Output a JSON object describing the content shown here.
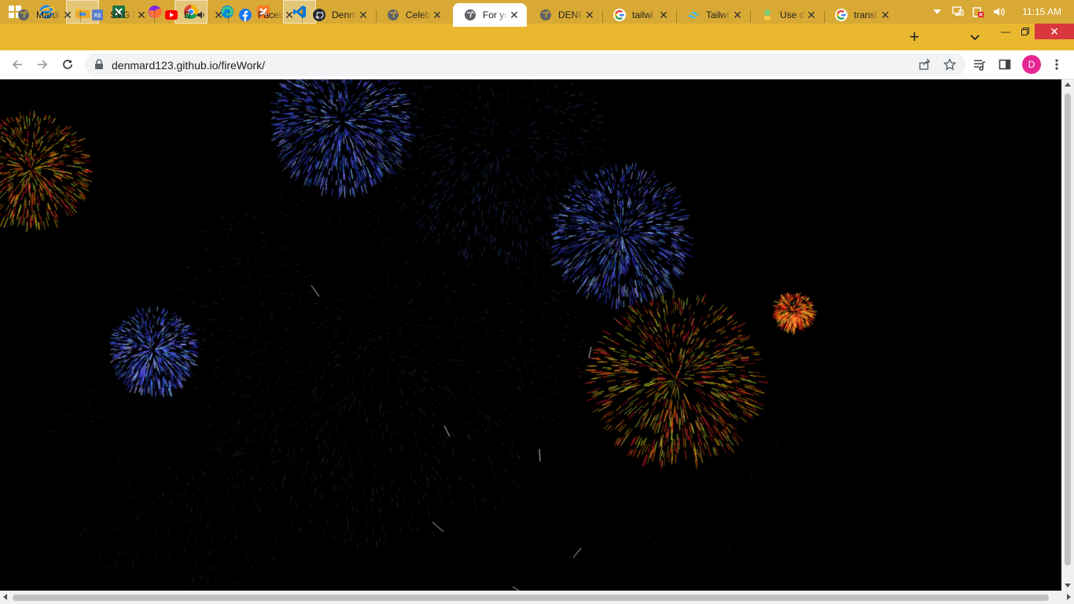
{
  "taskbar": {
    "apps": [
      {
        "name": "internet-explorer-icon",
        "active": false
      },
      {
        "name": "file-explorer-icon",
        "active": true
      },
      {
        "name": "excel-icon",
        "active": false
      },
      {
        "name": "firefox-icon",
        "active": false
      },
      {
        "name": "chrome-icon",
        "active": true
      },
      {
        "name": "edge-icon",
        "active": false
      },
      {
        "name": "xampp-icon",
        "active": false
      },
      {
        "name": "vscode-icon",
        "active": true
      }
    ],
    "clock": "11:15 AM"
  },
  "tabs": [
    {
      "title": "Mardi",
      "icon": "globe-icon",
      "active": false
    },
    {
      "title": "SVG F",
      "icon": "repo-icon",
      "active": false
    },
    {
      "title": "D",
      "icon": "youtube-icon",
      "active": false,
      "audio": true
    },
    {
      "title": "Faceb",
      "icon": "facebook-icon",
      "active": false
    },
    {
      "title": "Denm",
      "icon": "github-icon",
      "active": false
    },
    {
      "title": "Celeb",
      "icon": "globe-icon",
      "active": false
    },
    {
      "title": "For yo",
      "icon": "globe-icon",
      "active": true
    },
    {
      "title": "DENF",
      "icon": "globe-icon",
      "active": false
    },
    {
      "title": "tailwi",
      "icon": "google-icon",
      "active": false
    },
    {
      "title": "Tailwi",
      "icon": "tailwind-icon",
      "active": false
    },
    {
      "title": "Use d",
      "icon": "ext-icon",
      "active": false
    },
    {
      "title": "transl",
      "icon": "google-icon",
      "active": false
    }
  ],
  "addressbar": {
    "url": "denmard123.github.io/fireWork/"
  },
  "profile": {
    "initial": "D",
    "color": "#e52592"
  },
  "colors": {
    "taskbar": "#d8a934",
    "tabstrip": "#e9b82f",
    "page_bg": "#000000"
  }
}
